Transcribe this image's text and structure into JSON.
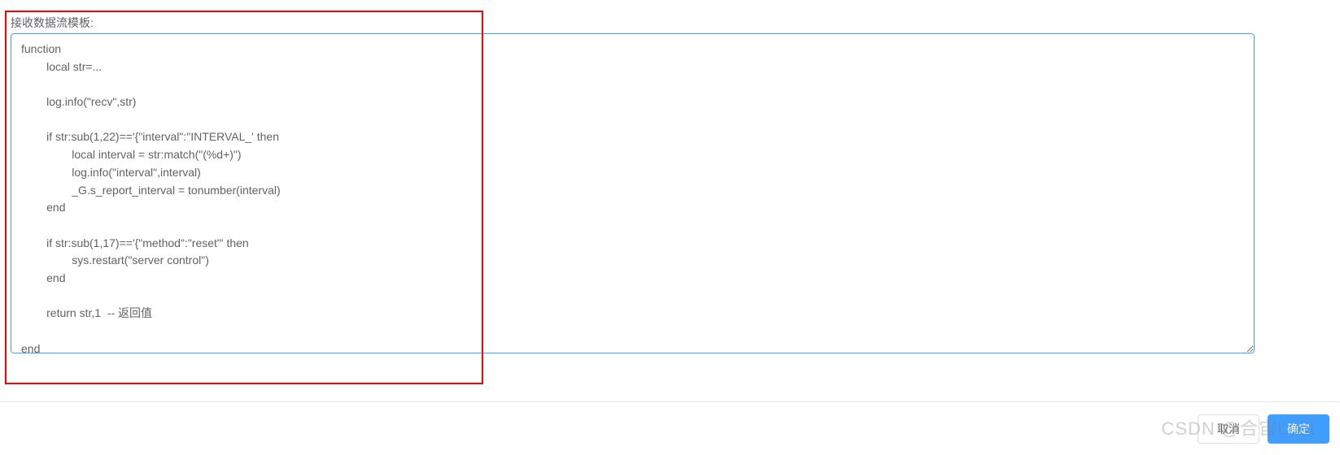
{
  "form": {
    "label": "接收数据流模板:",
    "code": "function\n        local str=...\n\n        log.info(\"recv\",str)\n\n        if str:sub(1,22)=='{\"interval\":\"INTERVAL_' then\n                local interval = str:match(\"(%d+)\")\n                log.info(\"interval\",interval)\n                _G.s_report_interval = tonumber(interval)\n        end\n\n        if str:sub(1,17)=='{\"method\":\"reset\"' then\n                sys.restart(\"server control\")\n        end\n\n        return str,1  -- 返回值\n\nend"
  },
  "buttons": {
    "cancel": "取消",
    "confirm": "确定"
  },
  "watermark": "CSDN @合宙Luat"
}
